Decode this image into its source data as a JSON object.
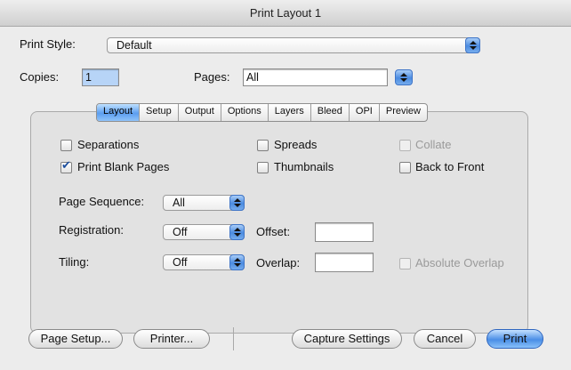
{
  "window": {
    "title": "Print Layout 1"
  },
  "print_style": {
    "label": "Print Style:",
    "value": "Default"
  },
  "copies": {
    "label": "Copies:",
    "value": "1"
  },
  "pages": {
    "label": "Pages:",
    "value": "All"
  },
  "tabs": [
    {
      "label": "Layout",
      "active": true
    },
    {
      "label": "Setup"
    },
    {
      "label": "Output"
    },
    {
      "label": "Options"
    },
    {
      "label": "Layers"
    },
    {
      "label": "Bleed"
    },
    {
      "label": "OPI"
    },
    {
      "label": "Preview"
    }
  ],
  "checkboxes": {
    "separations": {
      "label": "Separations",
      "checked": false,
      "enabled": true
    },
    "spreads": {
      "label": "Spreads",
      "checked": false,
      "enabled": true
    },
    "collate": {
      "label": "Collate",
      "checked": false,
      "enabled": false
    },
    "print_blank_pages": {
      "label": "Print Blank Pages",
      "checked": true,
      "enabled": true
    },
    "thumbnails": {
      "label": "Thumbnails",
      "checked": false,
      "enabled": true
    },
    "back_to_front": {
      "label": "Back to Front",
      "checked": false,
      "enabled": true
    },
    "absolute_overlap": {
      "label": "Absolute Overlap",
      "checked": false,
      "enabled": false
    }
  },
  "page_sequence": {
    "label": "Page Sequence:",
    "value": "All"
  },
  "registration": {
    "label": "Registration:",
    "value": "Off"
  },
  "offset": {
    "label": "Offset:",
    "value": ""
  },
  "tiling": {
    "label": "Tiling:",
    "value": "Off"
  },
  "overlap": {
    "label": "Overlap:",
    "value": ""
  },
  "buttons": {
    "page_setup": "Page Setup...",
    "printer": "Printer...",
    "capture_settings": "Capture Settings",
    "cancel": "Cancel",
    "print": "Print"
  },
  "colors": {
    "accent": "#4a8ee6",
    "window_bg": "#ececec",
    "panel_bg": "#e2e2e2"
  }
}
